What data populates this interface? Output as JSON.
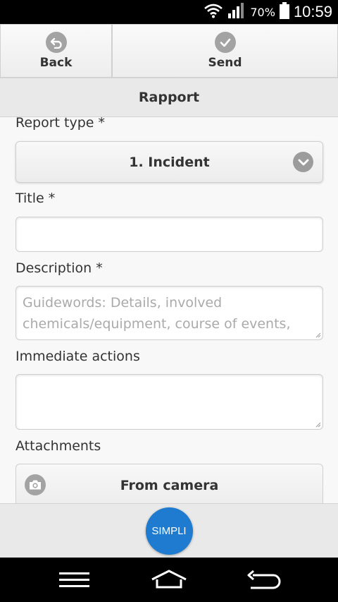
{
  "status_bar": {
    "battery_percent": "70%",
    "time": "10:59",
    "icons": [
      "wifi-icon",
      "signal-icon",
      "battery-icon"
    ]
  },
  "nav": {
    "back_label": "Back",
    "send_label": "Send"
  },
  "page_title": "Rapport",
  "form": {
    "report_type_label": "Report type *",
    "report_type_value": "1. Incident",
    "title_label": "Title *",
    "title_value": "",
    "description_label": "Description *",
    "description_placeholder": "Guidewords: Details, involved chemicals/equipment, course of events,",
    "immediate_actions_label": "Immediate actions",
    "immediate_actions_value": "",
    "attachments_label": "Attachments",
    "from_camera_label": "From camera"
  },
  "footer": {
    "simpli_label": "SIMPLI"
  },
  "colors": {
    "accent": "#1e7bd0",
    "icon_gray": "#a3a3a3",
    "header_bg": "#e9e9e9"
  },
  "system_nav": [
    "menu-icon",
    "home-icon",
    "back-arrow-icon"
  ]
}
